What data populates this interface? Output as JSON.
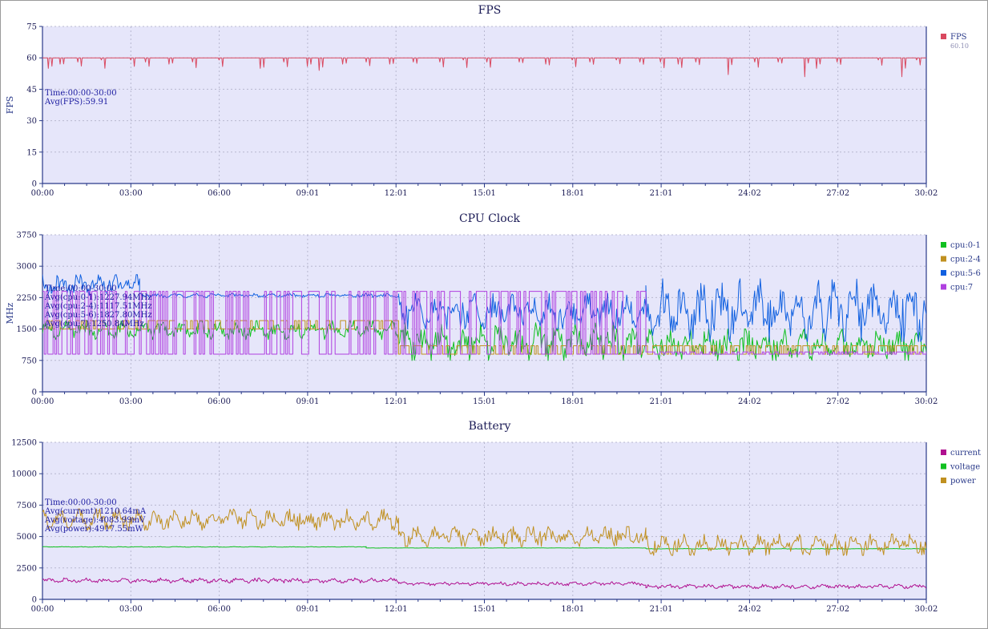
{
  "x_ticks": [
    "00:00",
    "03:00",
    "06:00",
    "09:01",
    "12:01",
    "15:01",
    "18:01",
    "21:01",
    "24:02",
    "27:02",
    "30:02"
  ],
  "chart_data": [
    {
      "type": "line",
      "title": "FPS",
      "ylabel": "FPS",
      "xlabel": "",
      "ylim": [
        0,
        75
      ],
      "yticks": [
        "0",
        "15",
        "30",
        "45",
        "60",
        "75"
      ],
      "xlim_minutes": [
        0,
        30.03
      ],
      "legend_position": "right",
      "annotations": [
        "Time:00:00-30:00",
        "Avg(FPS):59.91"
      ],
      "series": [
        {
          "name": "FPS",
          "subtitle": "60.10",
          "color": "#d9485f",
          "baseline": 60,
          "dips": [
            [
              0.2,
              55
            ],
            [
              0.6,
              57
            ],
            [
              1.2,
              58
            ],
            [
              2.0,
              59
            ],
            [
              3.0,
              59
            ],
            [
              3.5,
              58
            ],
            [
              4.3,
              57
            ],
            [
              5.1,
              58
            ],
            [
              6.0,
              59
            ],
            [
              7.4,
              55
            ],
            [
              8.2,
              58
            ],
            [
              9.0,
              56
            ],
            [
              9.4,
              54
            ],
            [
              10.2,
              57
            ],
            [
              11.0,
              58
            ],
            [
              11.8,
              57
            ],
            [
              12.6,
              58
            ],
            [
              13.5,
              58
            ],
            [
              14.3,
              59
            ],
            [
              15.1,
              58
            ],
            [
              16.2,
              58
            ],
            [
              17.1,
              57
            ],
            [
              18.0,
              59
            ],
            [
              18.6,
              58
            ],
            [
              19.5,
              59
            ],
            [
              20.3,
              58
            ],
            [
              21.0,
              58
            ],
            [
              21.6,
              57
            ],
            [
              22.2,
              58
            ],
            [
              23.3,
              52
            ],
            [
              24.2,
              58
            ],
            [
              25.0,
              58
            ],
            [
              25.9,
              51
            ],
            [
              26.3,
              55
            ],
            [
              27.0,
              58
            ],
            [
              28.4,
              59
            ],
            [
              29.2,
              51
            ],
            [
              29.7,
              59
            ]
          ]
        }
      ]
    },
    {
      "type": "line",
      "title": "CPU Clock",
      "ylabel": "MHz",
      "xlabel": "",
      "ylim": [
        0,
        3750
      ],
      "yticks": [
        "0",
        "750",
        "1500",
        "2250",
        "3000",
        "3750"
      ],
      "xlim_minutes": [
        0,
        30.03
      ],
      "legend_position": "right",
      "annotations": [
        "Time:00:00-30:00",
        "Avg(cpu:0-1):1227.94MHz",
        "Avg(cpu:2-4):1117.51MHz",
        "Avg(cpu:5-6):1827.80MHz",
        "Avg(cpu:7):1250.84MHz"
      ],
      "series": [
        {
          "name": "cpu:0-1",
          "color": "#10c020",
          "segments": [
            [
              0,
              12.1,
              1250,
              1700
            ],
            [
              12.1,
              20.5,
              750,
              1650
            ],
            [
              20.5,
              30.03,
              750,
              1500
            ]
          ]
        },
        {
          "name": "cpu:2-4",
          "color": "#c09020",
          "segments": [
            [
              0,
              12.1,
              1500,
              1700
            ],
            [
              12.1,
              30.03,
              900,
              1100
            ]
          ]
        },
        {
          "name": "cpu:5-6",
          "color": "#1060e0",
          "segments": [
            [
              0,
              3.3,
              2300,
              2800
            ],
            [
              3.3,
              12.1,
              2250,
              2350
            ],
            [
              12.1,
              20.5,
              1500,
              2350
            ],
            [
              20.5,
              30.03,
              1200,
              2700
            ]
          ]
        },
        {
          "name": "cpu:7",
          "color": "#b040e0",
          "segments": [
            [
              0,
              12.1,
              900,
              2400
            ],
            [
              12.1,
              20.5,
              900,
              2400
            ],
            [
              20.5,
              30.03,
              900,
              950
            ]
          ]
        }
      ]
    },
    {
      "type": "line",
      "title": "Battery",
      "ylabel": "",
      "xlabel": "",
      "ylim": [
        0,
        12500
      ],
      "yticks": [
        "0",
        "2500",
        "5000",
        "7500",
        "10000",
        "12500"
      ],
      "xlim_minutes": [
        0,
        30.03
      ],
      "legend_position": "right",
      "annotations": [
        "Time:00:00-30:00",
        "Avg(current):1210.64mA",
        "Avg(voltage):4083.99mV",
        "Avg(power):4917.55mW"
      ],
      "series": [
        {
          "name": "current",
          "color": "#b01090",
          "segments": [
            [
              0,
              12.1,
              1300,
              1700
            ],
            [
              12.1,
              20.5,
              1100,
              1400
            ],
            [
              20.5,
              30.03,
              850,
              1200
            ]
          ]
        },
        {
          "name": "voltage",
          "color": "#10c020",
          "segments": [
            [
              0,
              11.0,
              4150,
              4200
            ],
            [
              11.0,
              20.5,
              4080,
              4100
            ],
            [
              20.5,
              30.03,
              4000,
              4050
            ]
          ]
        },
        {
          "name": "power",
          "color": "#c09020",
          "segments": [
            [
              0,
              12.1,
              5500,
              7200
            ],
            [
              12.1,
              20.5,
              4200,
              5800
            ],
            [
              20.5,
              30.03,
              3500,
              5200
            ]
          ]
        }
      ]
    }
  ]
}
